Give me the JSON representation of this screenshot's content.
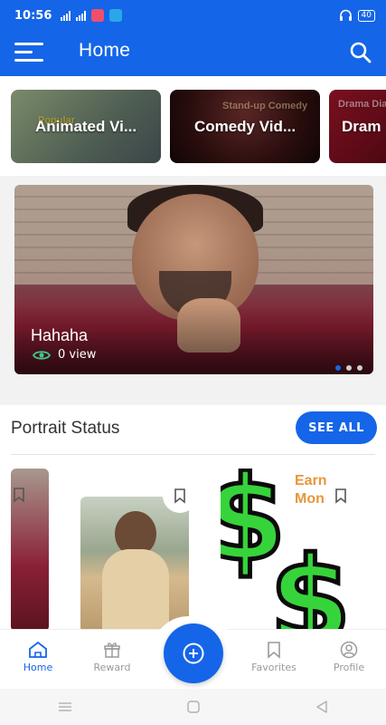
{
  "status_bar": {
    "time": "10:56",
    "battery": "40"
  },
  "app_bar": {
    "title": "Home",
    "menu_icon": "hamburger-icon",
    "search_icon": "search-icon",
    "color": "#1565e8"
  },
  "categories": [
    {
      "label": "Animated Vi...",
      "bg_text": "Popular"
    },
    {
      "label": "Comedy Vid...",
      "bg_text": "Stand-up Comedy"
    },
    {
      "label": "Dram",
      "bg_text": "Drama Dialogue"
    }
  ],
  "featured": {
    "title": "Hahaha",
    "views": "0 view",
    "view_icon": "eye-icon",
    "slide_count": 3,
    "active_slide": 1
  },
  "portrait_section": {
    "title": "Portrait Status",
    "see_all_label": "SEE ALL",
    "cards": [
      {
        "name": "portrait-card-1"
      },
      {
        "name": "portrait-card-2"
      },
      {
        "name": "portrait-card-3",
        "overlay_text": "Earn Money"
      }
    ]
  },
  "bottom_nav": {
    "items": [
      {
        "label": "Home",
        "icon": "home-icon",
        "active": true
      },
      {
        "label": "Reward",
        "icon": "reward-icon",
        "active": false
      },
      {
        "label": "Favorites",
        "icon": "bookmark-icon",
        "active": false
      },
      {
        "label": "Profile",
        "icon": "profile-icon",
        "active": false
      }
    ],
    "fab_icon": "add-circle-icon"
  },
  "system_nav": {
    "icons": [
      "menu-icon",
      "home-square-icon",
      "back-triangle-icon"
    ]
  }
}
